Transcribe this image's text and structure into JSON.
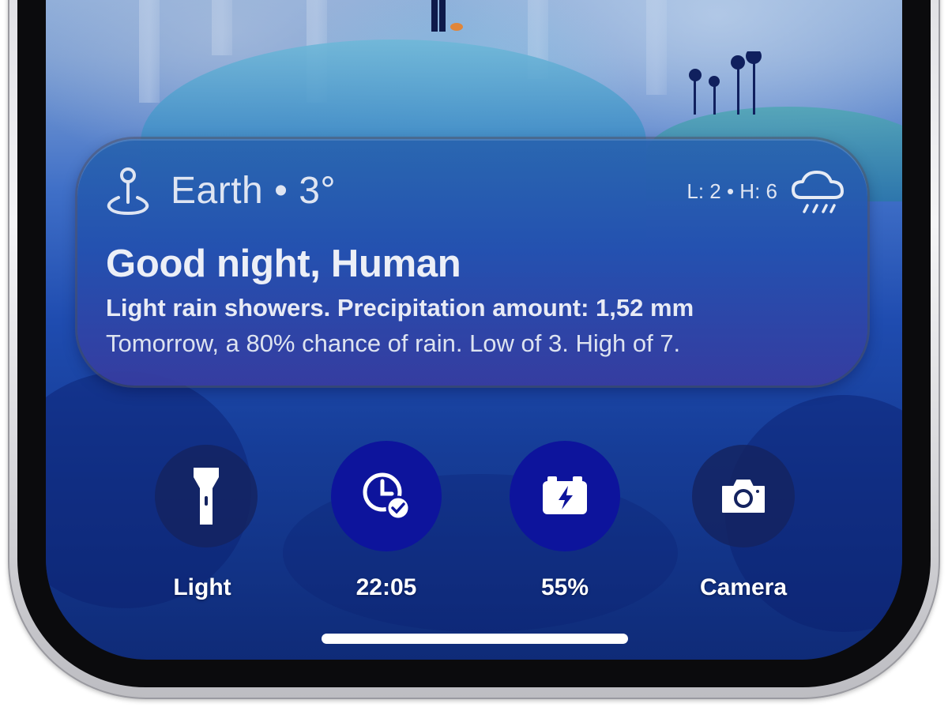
{
  "weather": {
    "location_label": "Earth • 3°",
    "hilo_label": "L: 2 • H: 6",
    "greeting": "Good night, Human",
    "summary": "Light rain showers. Precipitation amount: 1,52 mm",
    "forecast": "Tomorrow, a 80% chance of rain. Low of 3. High of 7.",
    "location_icon": "location-pin-icon",
    "condition_icon": "rain-cloud-icon"
  },
  "quick_actions": [
    {
      "label": "Light",
      "icon": "flashlight-icon",
      "style": "dim"
    },
    {
      "label": "22:05",
      "icon": "clock-check-icon",
      "style": "bright"
    },
    {
      "label": "55%",
      "icon": "battery-charging-icon",
      "style": "bright"
    },
    {
      "label": "Camera",
      "icon": "camera-icon",
      "style": "dim"
    }
  ],
  "colors": {
    "widget_bg": "#2456ae",
    "bright_button": "#0d149c",
    "dim_button": "#14235f",
    "text": "#ffffff"
  }
}
